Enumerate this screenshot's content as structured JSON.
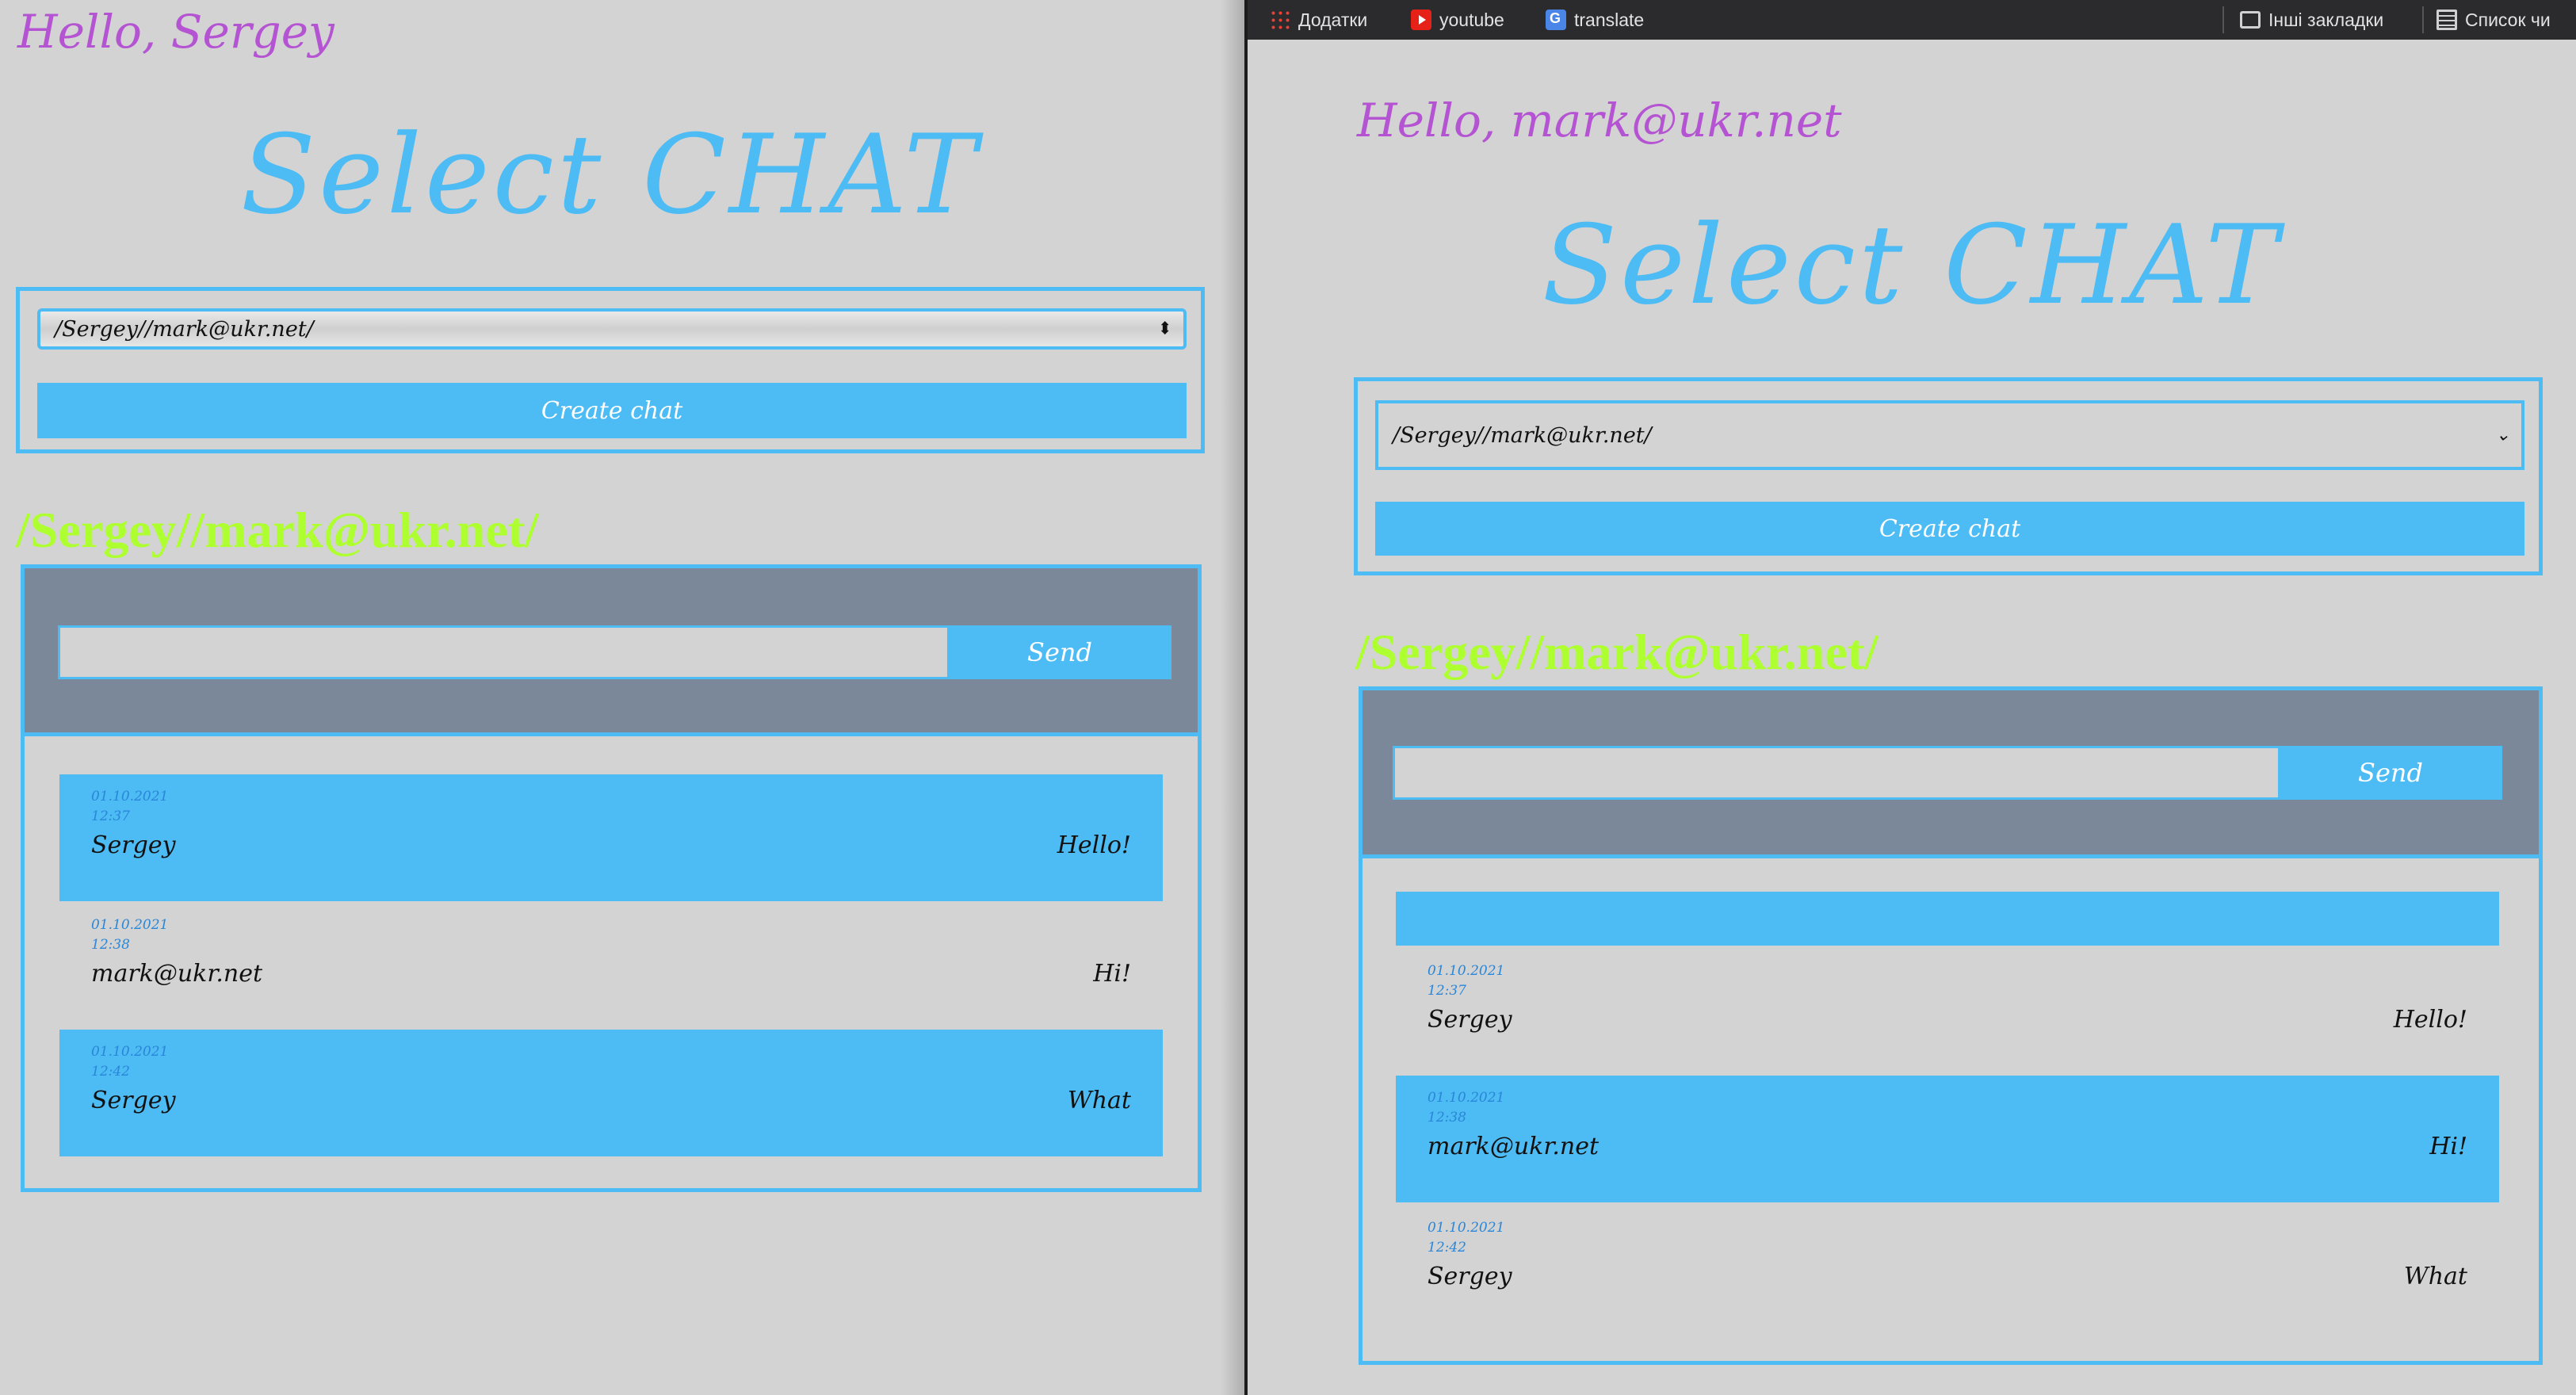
{
  "bookmarks_bar": {
    "apps": "Додатки",
    "youtube": "youtube",
    "translate": "translate",
    "other_bookmarks": "Інші закладки",
    "reading_list": "Список чи"
  },
  "colors": {
    "accent_blue": "#4dbbf4",
    "greeting_purple": "#b554d2",
    "chat_name_green": "#adff2f",
    "chat_header_gray": "#7b8899",
    "background": "#d3d3d3"
  },
  "left": {
    "greeting": "Hello, Sergey",
    "page_title": "Select CHAT",
    "select_value": "/Sergey//mark@ukr.net/",
    "create_chat_label": "Create chat",
    "chat_name": "/Sergey//mark@ukr.net/",
    "send_label": "Send",
    "message_input_value": "",
    "messages": [
      {
        "date": "01.10.2021",
        "time": "12:37",
        "author": "Sergey",
        "text": "Hello!"
      },
      {
        "date": "01.10.2021",
        "time": "12:38",
        "author": "mark@ukr.net",
        "text": "Hi!"
      },
      {
        "date": "01.10.2021",
        "time": "12:42",
        "author": "Sergey",
        "text": "What"
      }
    ]
  },
  "right": {
    "greeting": "Hello, mark@ukr.net",
    "page_title": "Select CHAT",
    "select_value": "/Sergey//mark@ukr.net/",
    "create_chat_label": "Create chat",
    "chat_name": "/Sergey//mark@ukr.net/",
    "send_label": "Send",
    "message_input_value": "",
    "messages": [
      {
        "date": "01.10.2021",
        "time": "12:37",
        "author": "Sergey",
        "text": "Hello!"
      },
      {
        "date": "01.10.2021",
        "time": "12:38",
        "author": "mark@ukr.net",
        "text": "Hi!"
      },
      {
        "date": "01.10.2021",
        "time": "12:42",
        "author": "Sergey",
        "text": "What"
      }
    ]
  }
}
